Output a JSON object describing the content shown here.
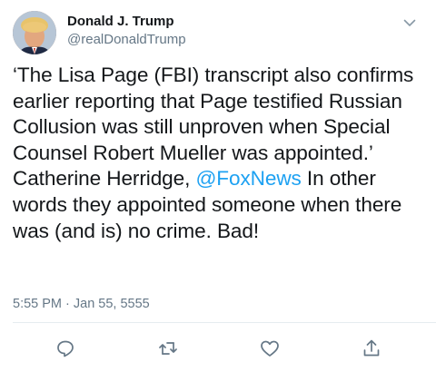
{
  "user": {
    "display_name": "Donald J. Trump",
    "handle": "@realDonaldTrump"
  },
  "tweet": {
    "text_before": "‘The Lisa Page (FBI) transcript also confirms earlier reporting that Page testified Russian Collusion was still unproven when Special Counsel Robert Mueller was appointed.’ Catherine Herridge, ",
    "mention": "@FoxNews",
    "text_after": " In other words they appointed someone when there was (and is) no crime. Bad!",
    "timestamp": "5:55 PM · Jan 55, 5555"
  },
  "icons": {
    "avatar": "profile-photo",
    "menu": "chevron-down-icon",
    "reply": "reply-icon",
    "retweet": "retweet-icon",
    "like": "heart-icon",
    "share": "share-icon"
  },
  "colors": {
    "text": "#14171a",
    "secondary": "#657786",
    "link": "#1da1f2",
    "divider": "#e6ecf0"
  }
}
